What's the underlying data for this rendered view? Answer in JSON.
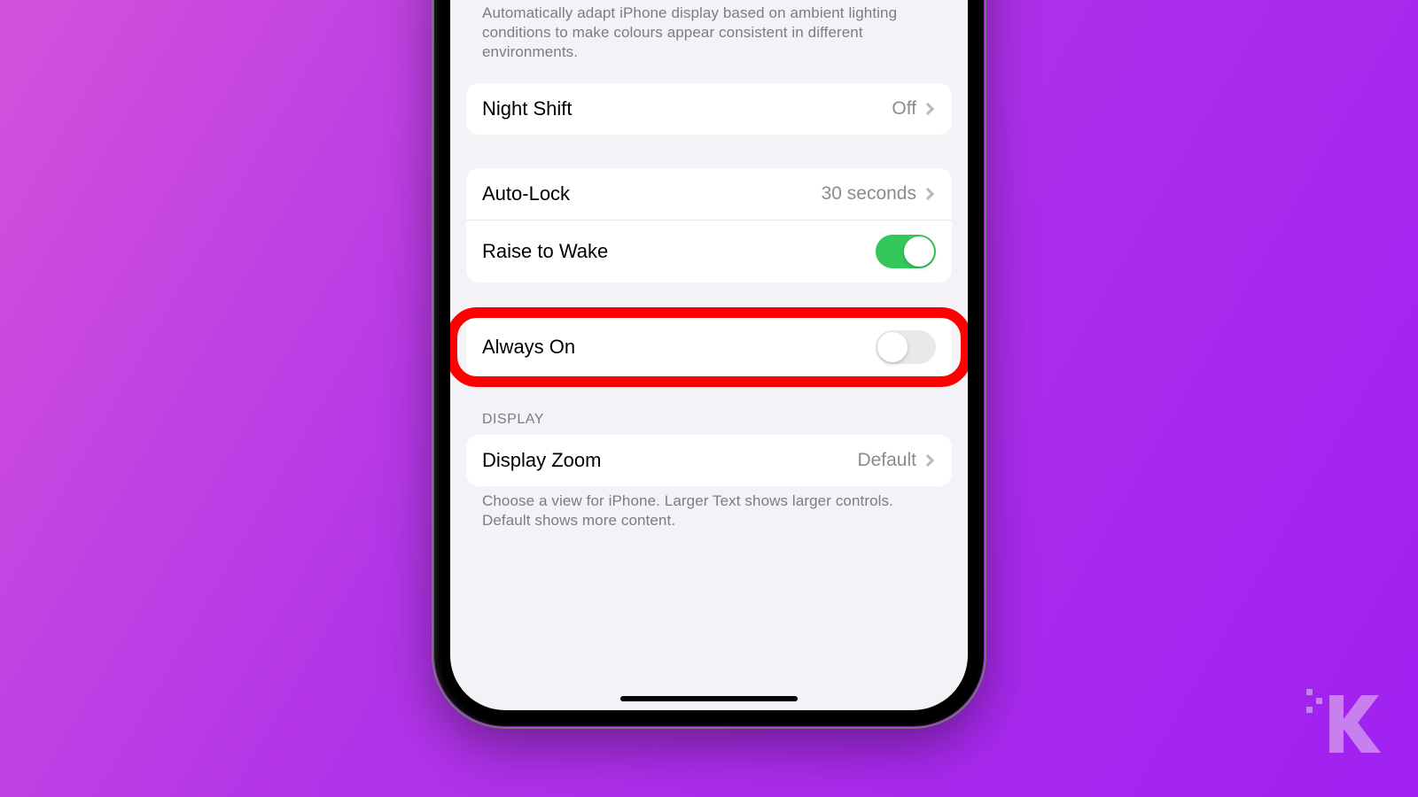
{
  "trueTone": {
    "caption": "Automatically adapt iPhone display based on ambient lighting conditions to make colours appear consistent in different environments."
  },
  "nightShift": {
    "label": "Night Shift",
    "value": "Off"
  },
  "autoLock": {
    "label": "Auto-Lock",
    "value": "30 seconds"
  },
  "raiseToWake": {
    "label": "Raise to Wake",
    "enabled": true
  },
  "alwaysOn": {
    "label": "Always On",
    "enabled": false
  },
  "displaySection": {
    "header": "DISPLAY"
  },
  "displayZoom": {
    "label": "Display Zoom",
    "value": "Default",
    "caption": "Choose a view for iPhone. Larger Text shows larger controls. Default shows more content."
  }
}
